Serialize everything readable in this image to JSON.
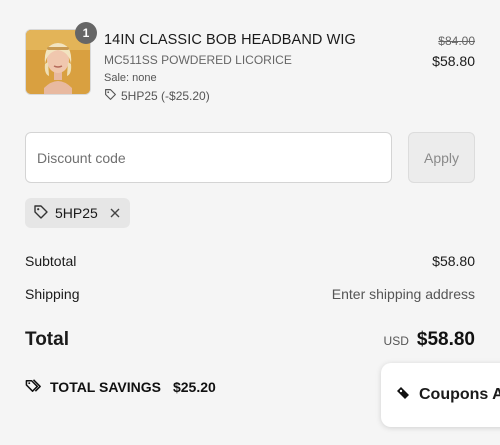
{
  "product": {
    "quantity": "1",
    "title": "14IN CLASSIC BOB HEADBAND WIG",
    "variant": "MC511SS POWDERED LICORICE",
    "sale": "Sale: none",
    "discount": "5HP25 (-$25.20)",
    "compare_price": "$84.00",
    "price": "$58.80"
  },
  "discount_form": {
    "placeholder": "Discount code",
    "value": "",
    "apply_label": "Apply"
  },
  "applied_code": {
    "code": "5HP25"
  },
  "summary": {
    "subtotal_label": "Subtotal",
    "subtotal_value": "$58.80",
    "shipping_label": "Shipping",
    "shipping_value": "Enter shipping address",
    "total_label": "Total",
    "currency": "USD",
    "total_value": "$58.80"
  },
  "savings": {
    "label": "TOTAL SAVINGS",
    "amount": "$25.20"
  },
  "coupons_widget": {
    "label": "Coupons A"
  },
  "icons": {
    "discount_tag": "tag-icon",
    "remove": "close-icon",
    "savings": "tags-icon",
    "coupons": "ticket-icon"
  }
}
